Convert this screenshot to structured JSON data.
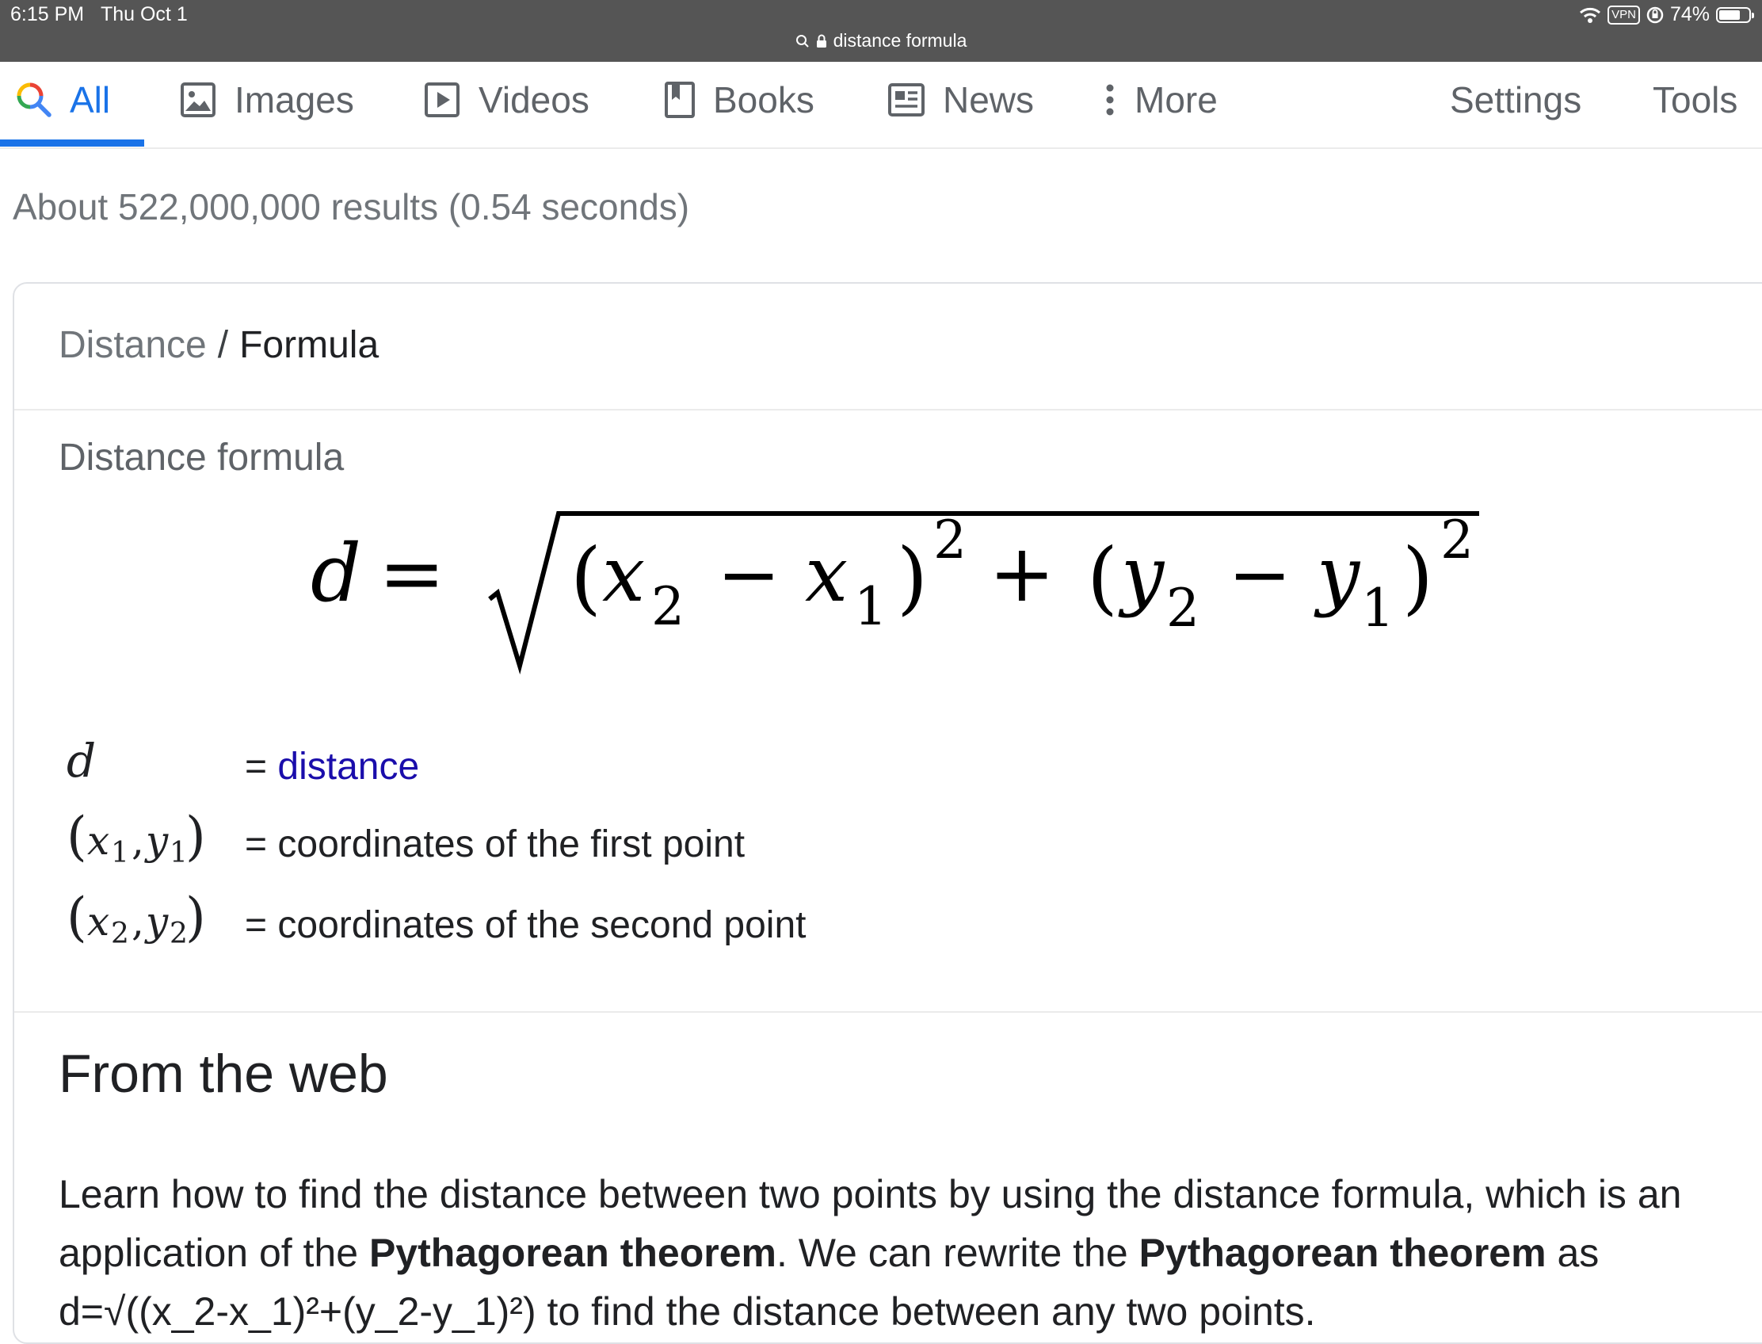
{
  "status": {
    "time": "6:15 PM",
    "date": "Thu Oct 1",
    "vpn": "VPN",
    "battery": "74%",
    "battery_level": 0.74,
    "url": "distance formula"
  },
  "tabs": {
    "all": "All",
    "images": "Images",
    "videos": "Videos",
    "books": "Books",
    "news": "News",
    "more": "More",
    "settings": "Settings",
    "tools": "Tools"
  },
  "result_stats": "About 522,000,000 results (0.54 seconds)",
  "breadcrumb": {
    "parent": "Distance",
    "separator": "/",
    "current": "Formula"
  },
  "section_label": "Distance formula",
  "formula": {
    "lhs": "d",
    "equals": "=",
    "x2": "x",
    "x1": "x",
    "y2": "y",
    "y1": "y",
    "sub1": "1",
    "sub2": "2",
    "exp": "2",
    "minus": "−",
    "plus": "+",
    "open": "(",
    "close": ")"
  },
  "variables": [
    {
      "symbol": "d",
      "equals": "=",
      "definition": "distance"
    },
    {
      "symbol": "(x1, y1)",
      "equals": "=",
      "definition": "coordinates of the first point"
    },
    {
      "symbol": "(x2, y2)",
      "equals": "=",
      "definition": "coordinates of the second point"
    }
  ],
  "web": {
    "heading": "From the web",
    "p1": "Learn how to find the distance between two points by using the distance formula, which is an application of the ",
    "bold1": "Pythagorean theorem",
    "p2": ". We can rewrite the ",
    "bold2": "Pythagorean theorem",
    "p3": " as d=√((x_2-x_1)²+(y_2-y_1)²) to find the distance between any two points."
  }
}
